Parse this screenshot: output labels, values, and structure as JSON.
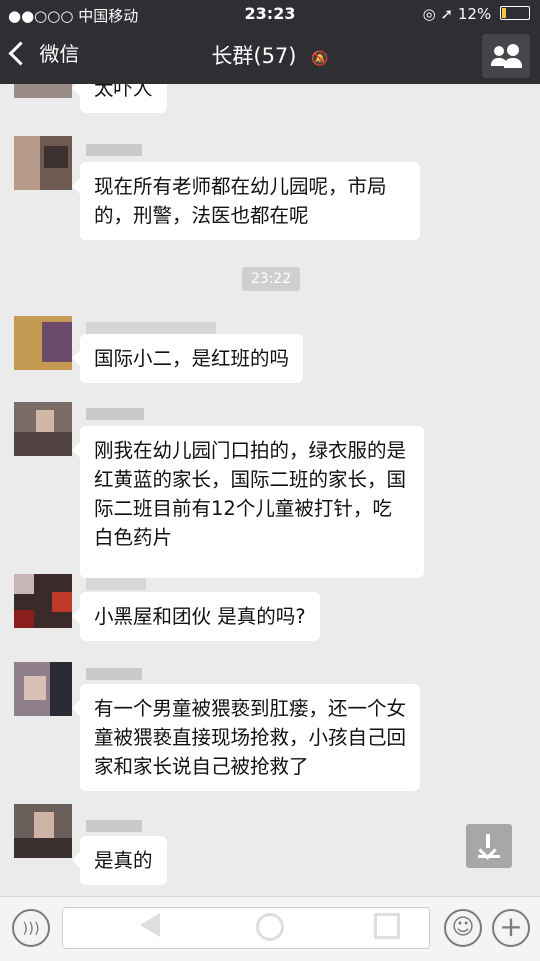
{
  "status_bar": {
    "carrier": "●●○○○ 中国移动",
    "wifi_icon": "wifi-icon",
    "time": "23:23",
    "indicators": "◎ ➚ 12%"
  },
  "nav": {
    "back_label": "微信",
    "title": "长群(57)",
    "mute_icon": "mute-icon",
    "group_icon": "group-info-icon"
  },
  "chat": {
    "timestamp": "23:22",
    "messages": [
      {
        "text": "太吓人"
      },
      {
        "text": "现在所有老师都在幼儿园呢，市局的，刑警，法医也都在呢"
      },
      {
        "text": "国际小二，是红班的吗"
      },
      {
        "text": "刚我在幼儿园门口拍的，绿衣服的是红黄蓝的家长，国际二班的家长，国际二班目前有12个儿童被打针，吃白色药片"
      },
      {
        "text": "小黑屋和团伙 是真的吗?"
      },
      {
        "text": "有一个男童被猥亵到肛瘘，还一个女童被猥亵直接现场抢救，小孩自己回家和家长说自己被抢救了"
      },
      {
        "text": "是真的"
      }
    ]
  },
  "input_bar": {
    "voice_icon": "voice-icon",
    "emoji_icon": "emoji-icon",
    "plus_icon": "plus-icon"
  },
  "colors": {
    "header_bg": "#2e2e33",
    "chat_bg": "#ebebeb",
    "bubble_bg": "#ffffff"
  }
}
